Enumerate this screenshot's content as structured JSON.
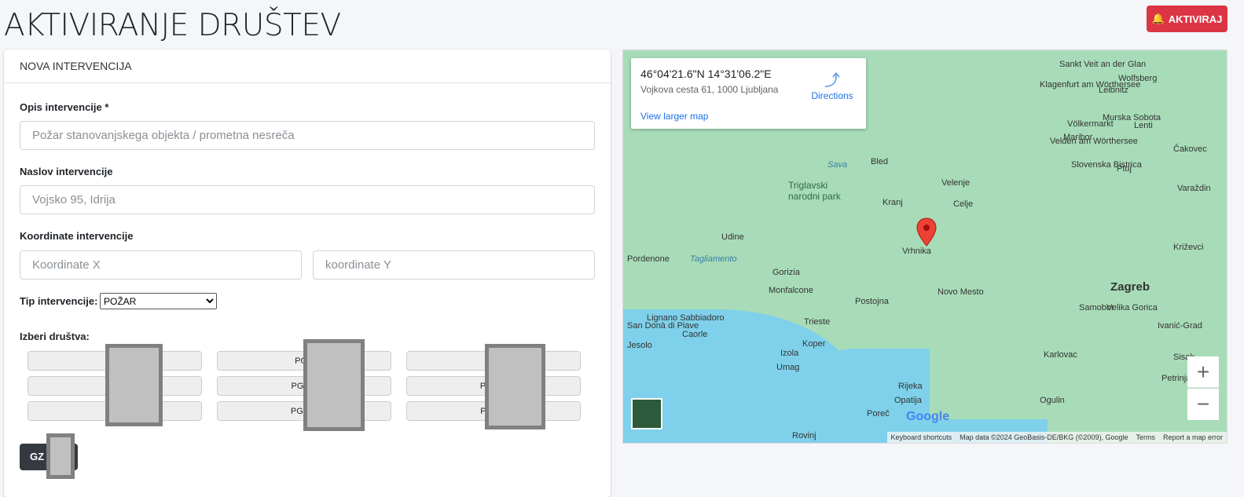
{
  "page": {
    "title": "AKTIVIRANJE DRUŠTEV",
    "activate_label": "AKTIVIRAJ",
    "accent": "#dc3545"
  },
  "form": {
    "header": "NOVA INTERVENCIJA",
    "opis_label": "Opis intervencije *",
    "opis_placeholder": "Požar stanovanjskega objekta / prometna nesreča",
    "naslov_label": "Naslov intervencije",
    "naslov_placeholder": "Vojsko 95, Idrija",
    "koord_label": "Koordinate intervencije",
    "x_placeholder": "Koordinate X",
    "y_placeholder": "koordinate Y",
    "tip_label": "Tip intervencije:",
    "tip_value": "POŽAR",
    "drustva_label": "Izberi društva:",
    "drustva": [
      "PGD",
      "PGD",
      "PGD",
      "PGD",
      "PGD L",
      "PGD S",
      "PGD",
      "PGD V",
      "PGD Z"
    ],
    "gz_label": "GZ"
  },
  "map": {
    "coords": "46°04'21.6\"N 14°31'06.2\"E",
    "address": "Vojkova cesta 61, 1000 Ljubljana",
    "directions": "Directions",
    "larger": "View larger map",
    "labels": [
      "Wolfsberg",
      "Sankt Veit an der Glan",
      "Leibnitz",
      "Klagenfurt am Wörthersee",
      "Völkermarkt",
      "Murska Sobota",
      "Lenti",
      "Maribor",
      "Velden am Wörthersee",
      "Slovenska Bistrica",
      "Ptuj",
      "Čakovec",
      "Bled",
      "Triglavski narodni park",
      "Velenje",
      "Varaždin",
      "Kranj",
      "Celje",
      "Udine",
      "Pordenone",
      "Vrhnika",
      "Križevci",
      "Gorizia",
      "Zagreb",
      "Novo Mesto",
      "Samobor",
      "Monfalcone",
      "Postojna",
      "Velika Gorica",
      "Ivanić-Grad",
      "Lignano Sabbiadoro",
      "San Donà di Piave",
      "Caorle",
      "Trieste",
      "Jesolo",
      "Koper",
      "Izola",
      "Umag",
      "Karlovac",
      "Sisak",
      "Petrinja",
      "Rijeka",
      "Opatija",
      "Ogulin",
      "Poreč",
      "Rovinj",
      "Sava",
      "Tagliamento"
    ],
    "attribution": [
      "Keyboard shortcuts",
      "Map data ©2024 GeoBasis-DE/BKG (©2009), Google",
      "Terms",
      "Report a map error"
    ],
    "google": "Google"
  }
}
